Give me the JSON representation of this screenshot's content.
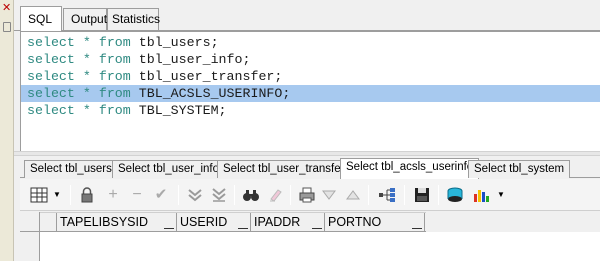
{
  "top_tabs": [
    {
      "label": "SQL",
      "active": true
    },
    {
      "label": "Output",
      "active": false
    },
    {
      "label": "Statistics",
      "active": false
    }
  ],
  "editor": {
    "lines": [
      {
        "kw1": "select",
        "kw2": "* from",
        "table": "tbl_users;",
        "selected": false
      },
      {
        "kw1": "select",
        "kw2": "* from",
        "table": "tbl_user_info;",
        "selected": false
      },
      {
        "kw1": "select",
        "kw2": "* from",
        "table": "tbl_user_transfer;",
        "selected": false
      },
      {
        "kw1": "select",
        "kw2": "* from",
        "table": "TBL_ACSLS_USERINFO;",
        "selected": true
      },
      {
        "kw1": "select",
        "kw2": "* from",
        "table": "TBL_SYSTEM;",
        "selected": false
      }
    ]
  },
  "result_tabs": [
    {
      "label": "Select tbl_users",
      "active": false
    },
    {
      "label": "Select tbl_user_info",
      "active": false
    },
    {
      "label": "Select tbl_user_transfer",
      "active": false
    },
    {
      "label": "Select tbl_acsls_userinfo",
      "active": true
    },
    {
      "label": "Select tbl_system",
      "active": false
    }
  ],
  "toolbar": {
    "icons": [
      "grid-view-icon",
      "lock-icon",
      "add-record-icon",
      "delete-record-icon",
      "post-edit-icon",
      "move-down-icon",
      "move-last-icon",
      "find-icon",
      "clear-icon",
      "print-icon",
      "sort-down-icon",
      "sort-up-icon",
      "tree-view-icon",
      "save-icon",
      "database-icon",
      "chart-icon"
    ]
  },
  "grid": {
    "columns": [
      "TAPELIBSYSID",
      "USERID",
      "IPADDR",
      "PORTNO"
    ]
  }
}
